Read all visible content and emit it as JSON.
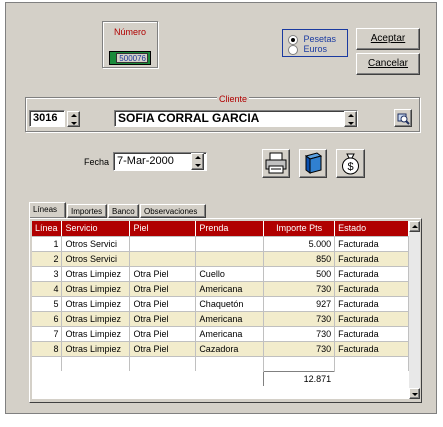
{
  "numero": {
    "label": "Número",
    "value": "500076"
  },
  "currency": {
    "options": [
      {
        "label": "Pesetas",
        "selected": true
      },
      {
        "label": "Euros",
        "selected": false
      }
    ]
  },
  "buttons": {
    "accept": "Aceptar",
    "cancel": "Cancelar"
  },
  "cliente": {
    "label": "Cliente",
    "code": "3016",
    "name": "SOFIA CORRAL GARCIA"
  },
  "fecha": {
    "label": "Fecha",
    "value": "7-Mar-2000"
  },
  "toolbar_icons": [
    "printer-icon",
    "book-icon",
    "money-bag-icon"
  ],
  "tabs": [
    "Líneas",
    "Importes",
    "Banco",
    "Observaciones"
  ],
  "table": {
    "headers": [
      "Línea",
      "Servicio",
      "Piel",
      "Prenda",
      "Importe Pts",
      "Estado"
    ],
    "rows": [
      [
        "1",
        "Otros Servici",
        "",
        "",
        "5.000",
        "Facturada"
      ],
      [
        "2",
        "Otros Servici",
        "",
        "",
        "850",
        "Facturada"
      ],
      [
        "3",
        "Otras Limpiez",
        "Otra Piel",
        "Cuello",
        "500",
        "Facturada"
      ],
      [
        "4",
        "Otras Limpiez",
        "Otra Piel",
        "Americana",
        "730",
        "Facturada"
      ],
      [
        "5",
        "Otras Limpiez",
        "Otra Piel",
        "Chaquetón",
        "927",
        "Facturada"
      ],
      [
        "6",
        "Otras Limpiez",
        "Otra Piel",
        "Americana",
        "730",
        "Facturada"
      ],
      [
        "7",
        "Otras Limpiez",
        "Otra Piel",
        "Americana",
        "730",
        "Facturada"
      ],
      [
        "8",
        "Otras Limpiez",
        "Otra Piel",
        "Cazadora",
        "730",
        "Facturada"
      ]
    ],
    "total": "12.871"
  },
  "colors": {
    "header_bg": "#b00000",
    "alt_row": "#f2eccc",
    "numero_box": "#1a8a3a",
    "window_bg": "#d4d0c8"
  }
}
